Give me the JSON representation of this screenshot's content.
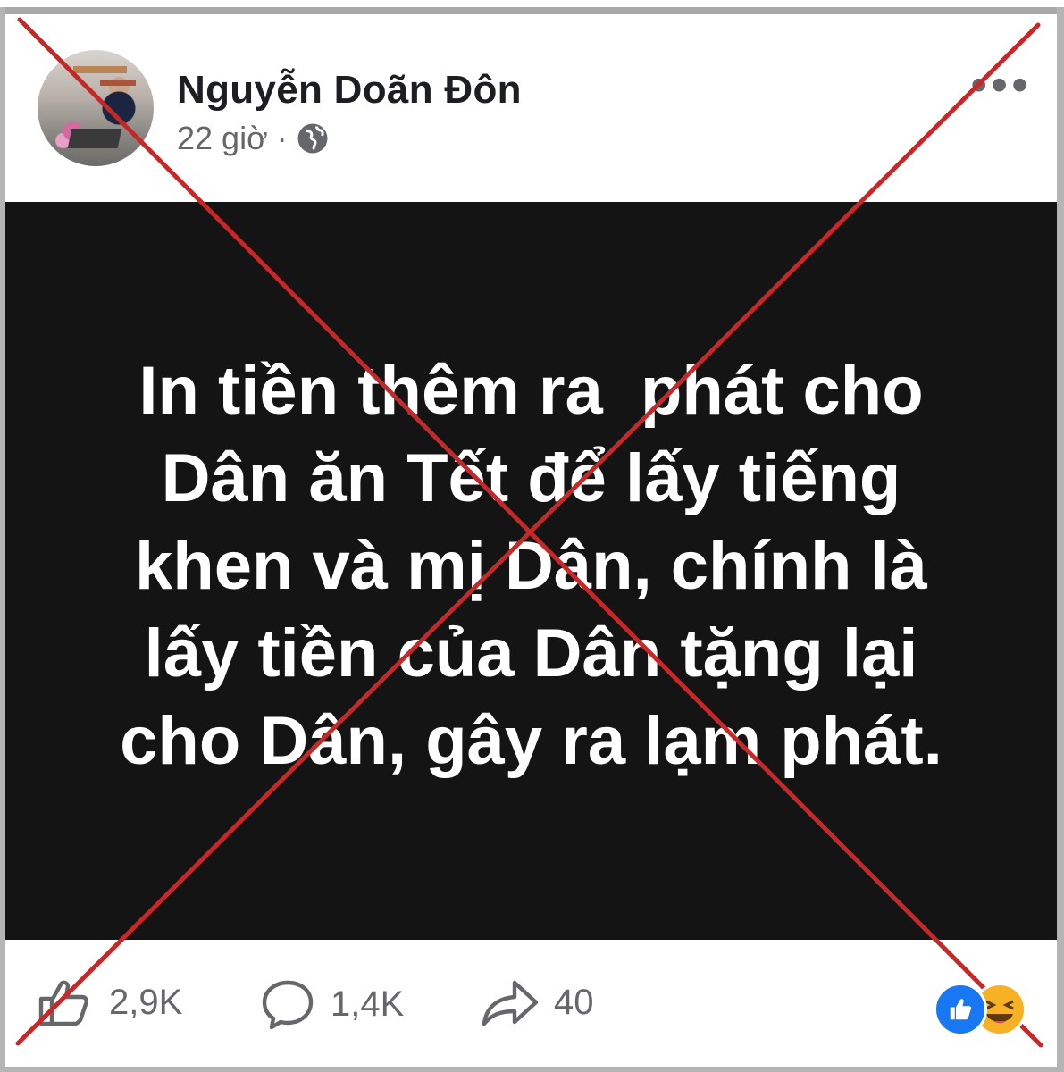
{
  "post": {
    "author_name": "Nguyễn Doãn Đôn",
    "time": "22 giờ",
    "separator": "·",
    "privacy_icon": "globe-icon",
    "more_icon": "more-options-icon",
    "more_label": "•••"
  },
  "image_text": {
    "lines": [
      "In tiền thêm ra  phát cho",
      "Dân ăn Tết để lấy tiếng",
      "khen và mị Dân, chính là",
      "lấy tiền của Dân tặng lại",
      "cho Dân, gây ra lạm phát."
    ]
  },
  "stats": {
    "likes": "2,9K",
    "comments": "1,4K",
    "shares": "40",
    "like_icon": "thumbs-up-icon",
    "comment_icon": "comment-icon",
    "share_icon": "share-arrow-icon",
    "reactions": [
      "like-reaction-icon",
      "haha-reaction-icon"
    ]
  },
  "overlay": {
    "mark": "red-x-cross",
    "color": "#c62828"
  },
  "colors": {
    "text_primary": "#1c1e21",
    "text_secondary": "#65676b",
    "image_background": "#141414",
    "like_blue": "#1877f2",
    "haha_yellow": "#f7b125"
  }
}
